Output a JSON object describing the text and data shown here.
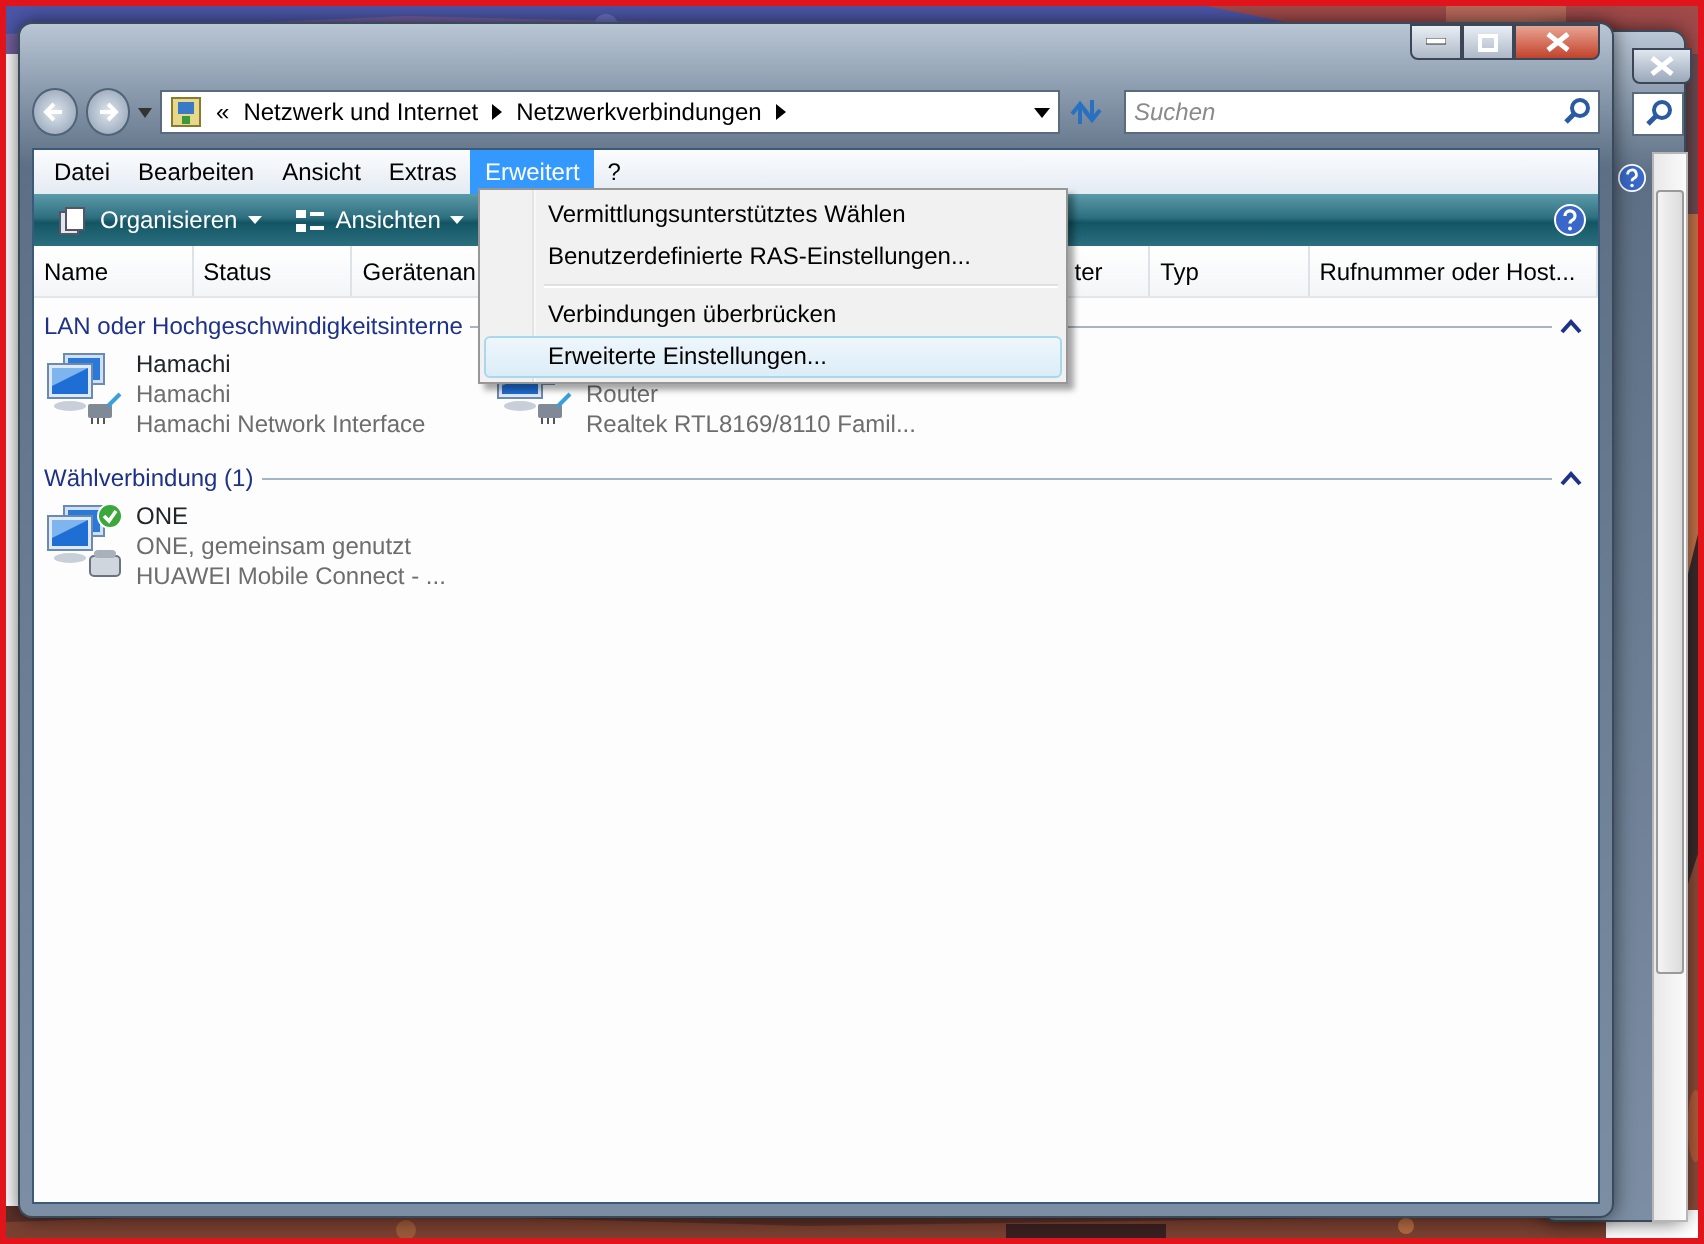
{
  "address_bar": {
    "crumb_prefix": "«",
    "crumbs": [
      "Netzwerk und Internet",
      "Netzwerkverbindungen"
    ],
    "search": {
      "placeholder": "Suchen"
    }
  },
  "menu_bar": [
    {
      "label": "Datei",
      "selected": false
    },
    {
      "label": "Bearbeiten",
      "selected": false
    },
    {
      "label": "Ansicht",
      "selected": false
    },
    {
      "label": "Extras",
      "selected": false
    },
    {
      "label": "Erweitert",
      "selected": true
    },
    {
      "label": "?",
      "selected": false
    }
  ],
  "toolbar": [
    {
      "label": "Organisieren",
      "kind": "organize"
    },
    {
      "label": "Ansichten",
      "kind": "views"
    }
  ],
  "columns": [
    "Name",
    "Status",
    "Gerätenan",
    "ter",
    "Typ",
    "Rufnummer oder Host..."
  ],
  "groups": [
    {
      "title": "LAN oder Hochgeschwindigkeitsinterne",
      "items": [
        {
          "name": "Hamachi",
          "status": "Hamachi",
          "device": "Hamachi Network Interface",
          "kind": "lan",
          "connected": false
        },
        {
          "status": "Router",
          "device": "Realtek RTL8169/8110 Famil...",
          "kind": "lan"
        }
      ]
    },
    {
      "title": "Wählverbindung (1)",
      "items": [
        {
          "name": "ONE",
          "status": "ONE, gemeinsam genutzt",
          "device": "HUAWEI Mobile Connect - ...",
          "kind": "dialup",
          "connected": true
        }
      ]
    }
  ],
  "dropdown_menu": [
    {
      "label": "Vermittlungsunterstütztes Wählen",
      "kind": "item",
      "selected": false
    },
    {
      "label": "Benutzerdefinierte RAS-Einstellungen...",
      "kind": "item",
      "selected": false
    },
    {
      "kind": "separator"
    },
    {
      "label": "Verbindungen überbrücken",
      "kind": "item",
      "selected": false
    },
    {
      "label": "Erweiterte Einstellungen...",
      "kind": "item",
      "selected": true
    }
  ]
}
